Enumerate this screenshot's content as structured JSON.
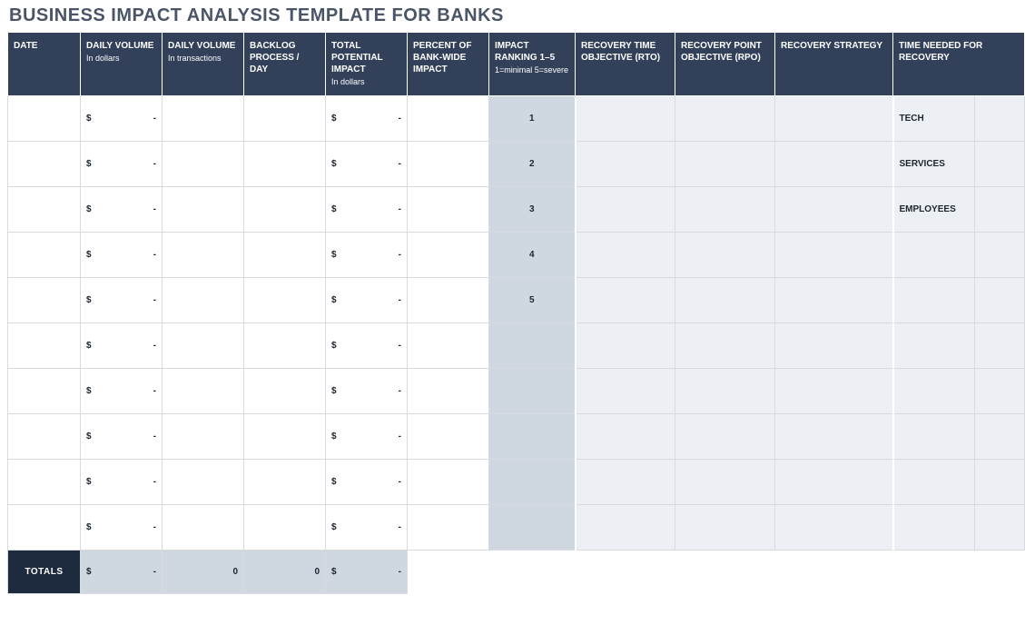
{
  "title": "BUSINESS IMPACT ANALYSIS TEMPLATE FOR BANKS",
  "headers": {
    "date": "DATE",
    "daily_volume_dollars": "DAILY VOLUME",
    "daily_volume_dollars_sub": "In dollars",
    "daily_volume_tx": "DAILY VOLUME",
    "daily_volume_tx_sub": "In transactions",
    "backlog": "BACKLOG PROCESS / DAY",
    "total_potential": "TOTAL POTENTIAL IMPACT",
    "total_potential_sub": "In dollars",
    "percent_bank": "PERCENT OF BANK-WIDE IMPACT",
    "impact_ranking": "IMPACT RANKING 1–5",
    "impact_ranking_sub": "1=minimal 5=severe",
    "rto": "RECOVERY TIME OBJECTIVE (RTO)",
    "rpo": "RECOVERY POINT OBJECTIVE (RPO)",
    "strategy": "RECOVERY STRATEGY",
    "time_needed": "TIME NEEDED FOR RECOVERY"
  },
  "currency_symbol": "$",
  "dash": "-",
  "zero": "0",
  "rows": [
    {
      "rank": "1",
      "time_label": "TECH"
    },
    {
      "rank": "2",
      "time_label": "SERVICES"
    },
    {
      "rank": "3",
      "time_label": "EMPLOYEES"
    },
    {
      "rank": "4",
      "time_label": ""
    },
    {
      "rank": "5",
      "time_label": ""
    },
    {
      "rank": "",
      "time_label": ""
    },
    {
      "rank": "",
      "time_label": ""
    },
    {
      "rank": "",
      "time_label": ""
    },
    {
      "rank": "",
      "time_label": ""
    },
    {
      "rank": "",
      "time_label": ""
    }
  ],
  "totals": {
    "label": "TOTALS",
    "daily_volume_dollars": "-",
    "daily_volume_tx": "0",
    "backlog": "0",
    "total_potential": "-"
  }
}
